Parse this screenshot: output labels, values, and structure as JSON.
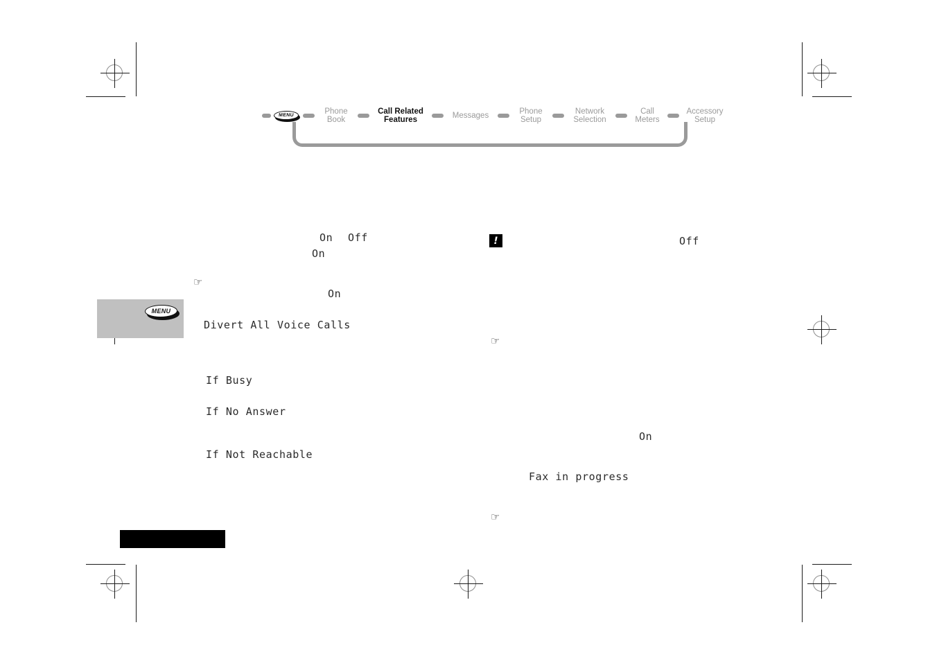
{
  "page": {
    "title": "Call Related Features",
    "background_color": "#ffffff",
    "accent_gray": "#9a9a9a",
    "callout_gray": "#c0c0c0"
  },
  "nav": {
    "menu_key_label": "MENU",
    "items": [
      {
        "line1": "Phone",
        "line2": "Book",
        "active": false
      },
      {
        "line1": "Call Related",
        "line2": "Features",
        "active": true
      },
      {
        "line1": "Messages",
        "line2": "",
        "active": false
      },
      {
        "line1": "Phone",
        "line2": "Setup",
        "active": false
      },
      {
        "line1": "Network",
        "line2": "Selection",
        "active": false
      },
      {
        "line1": "Call",
        "line2": "Meters",
        "active": false
      },
      {
        "line1": "Accessory",
        "line2": "Setup",
        "active": false
      }
    ]
  },
  "callout": {
    "menu_key_label": "MENU"
  },
  "lcd": {
    "on_1": "On",
    "off_1": "Off",
    "on_2": "On",
    "off_right": "Off",
    "on_3": "On",
    "divert_all_voice_calls": "Divert All Voice Calls",
    "if_busy": "If Busy",
    "if_no_answer": "If No Answer",
    "if_not_reachable": "If Not Reachable",
    "on_4": "On",
    "fax_in_progress": "Fax in progress"
  },
  "indicators": {
    "warning_glyph": "!"
  },
  "hand_pointers": {
    "glyph": "☞",
    "count": 3
  }
}
